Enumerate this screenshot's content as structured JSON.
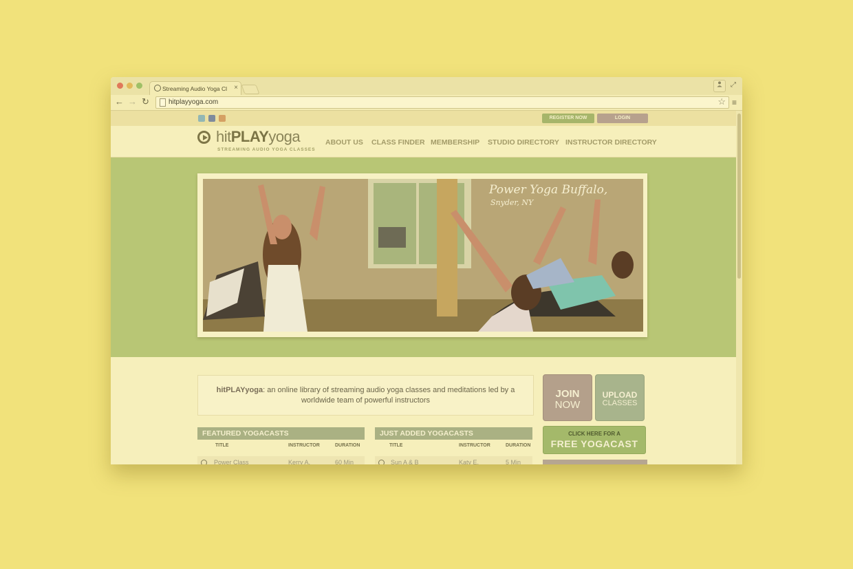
{
  "browser": {
    "tab_title": "Streaming Audio Yoga Cl",
    "tab_close": "×",
    "url": "hitplayyoga.com",
    "back_icon": "←",
    "forward_icon": "→",
    "reload_icon": "↻",
    "star_icon": "☆",
    "menu_icon": "≡",
    "user_icon": "👤",
    "fullscreen_icon": "⤢"
  },
  "site": {
    "top_buttons": {
      "register": "REGISTER NOW",
      "login": "LOGIN"
    },
    "logo": {
      "hit": "hit",
      "play": "PLAY",
      "yoga": "yoga",
      "tagline": "STREAMING AUDIO YOGA CLASSES"
    },
    "nav": [
      "ABOUT US",
      "CLASS FINDER",
      "MEMBERSHIP",
      "STUDIO DIRECTORY",
      "INSTRUCTOR DIRECTORY"
    ],
    "hero": {
      "caption": "Power Yoga Buffalo,",
      "sub_caption": "Snyder, NY"
    },
    "intro": {
      "brand": "hitPLAYyoga",
      "text": ": an online library of streaming audio yoga classes and meditations led by a worldwide team of powerful instructors"
    },
    "cta": {
      "join_1": "JOIN",
      "join_2": "NOW",
      "upload_1": "UPLOAD",
      "upload_2": "CLASSES",
      "free_small": "CLICK HERE FOR A",
      "free_big": "FREE YOGACAST"
    },
    "featured": {
      "heading": "FEATURED YOGACASTS",
      "columns": [
        "TITLE",
        "INSTRUCTOR",
        "DURATION"
      ],
      "rows": [
        {
          "title": "Power Class",
          "instructor": "Kerry A.",
          "duration": "60 Min"
        }
      ]
    },
    "just_added": {
      "heading": "JUST ADDED YOGACASTS",
      "columns": [
        "TITLE",
        "INSTRUCTOR",
        "DURATION"
      ],
      "rows": [
        {
          "title": "Sun A & B",
          "instructor": "Katy E.",
          "duration": "5 Min"
        }
      ]
    }
  }
}
